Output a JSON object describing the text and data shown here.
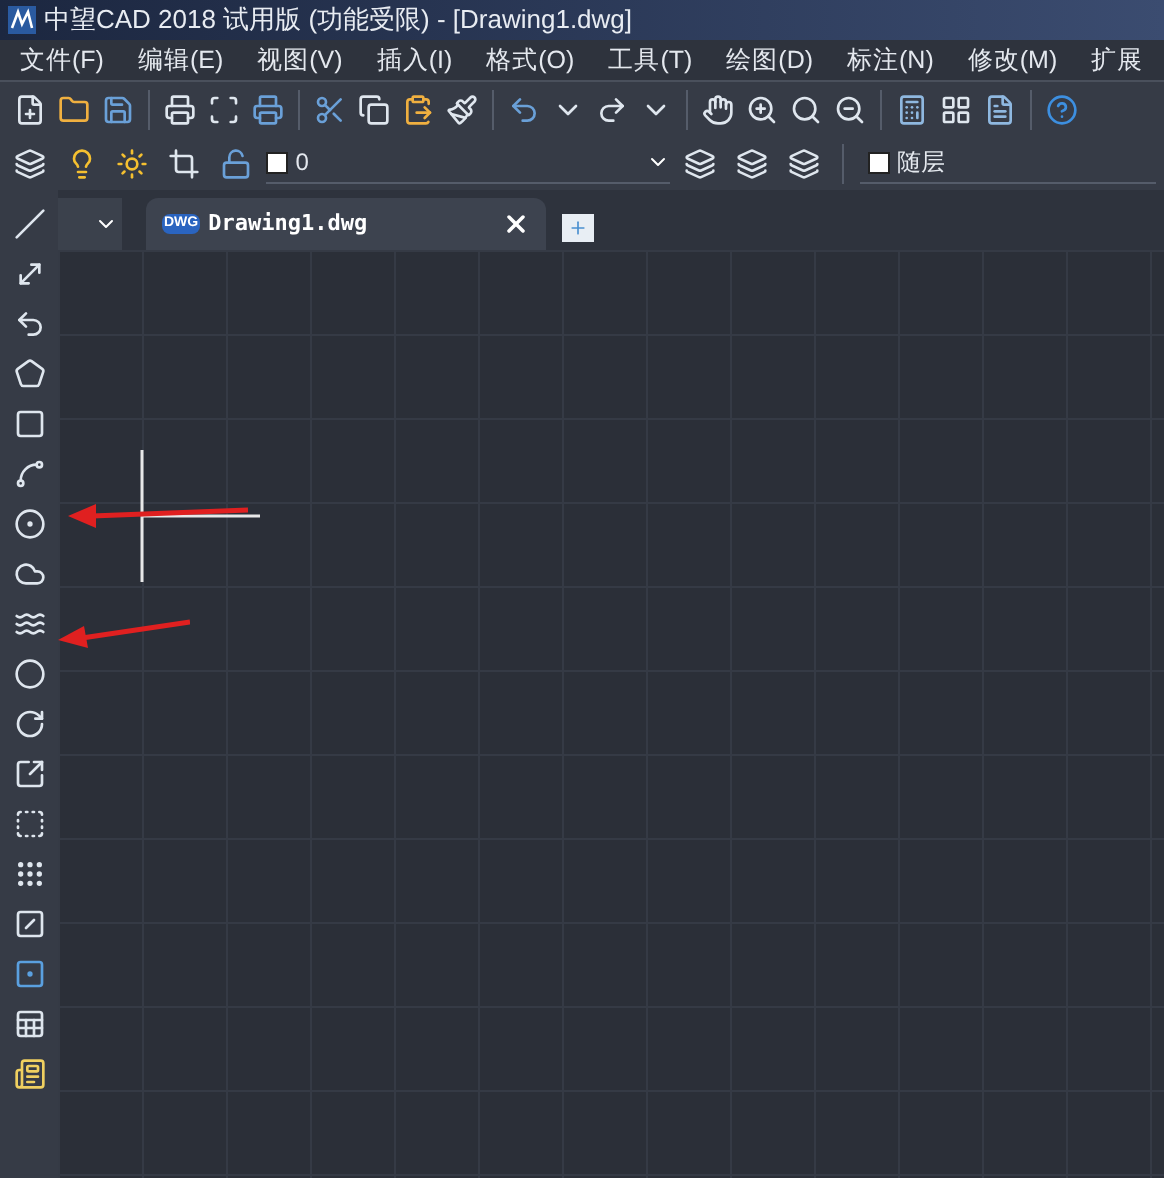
{
  "window": {
    "title": "中望CAD 2018 试用版 (功能受限) - [Drawing1.dwg]"
  },
  "menu": [
    "文件(F)",
    "编辑(E)",
    "视图(V)",
    "插入(I)",
    "格式(O)",
    "工具(T)",
    "绘图(D)",
    "标注(N)",
    "修改(M)",
    "扩展"
  ],
  "layer_bar": {
    "layer": "0",
    "color_setting": "随层"
  },
  "tabs": [
    {
      "label": "Drawing1.dwg",
      "icon_text": "DWG",
      "selected": true
    }
  ]
}
